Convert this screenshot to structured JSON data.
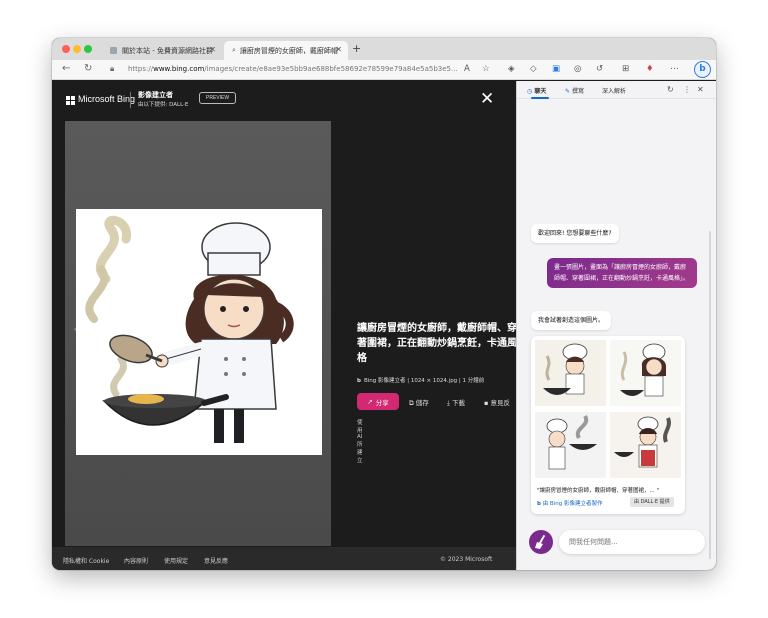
{
  "browser": {
    "tabs": [
      {
        "label": "關於本站 - 免費資源網路社群",
        "active": false
      },
      {
        "label": "讓廚房冒煙的女廚師，戴廚師帽",
        "active": true
      }
    ],
    "new_tab": "+",
    "url_prefix": "https://",
    "url_domain": "www.bing.com",
    "url_path": "/images/create/e8ae93e5bb9ae688bfe58692e78599e79a84e5a5b3e5...",
    "colors": {
      "accent": "#2c7be5"
    }
  },
  "viewer": {
    "brand": "Microsoft Bing",
    "creator_title": "影像建立者",
    "creator_sub": "由以下提供: DALL·E",
    "preview": "PREVIEW",
    "close": "✕",
    "image_title": "讓廚房冒煙的女廚師，戴廚師帽、穿著圍裙，正在翻動炒鍋烹飪，卡通風格",
    "meta": "Bing 影像建立者  |  1024 × 1024.jpg  |  1 分鐘前",
    "share": "分享",
    "save": "儲存",
    "download": "下載",
    "feedback": "意見反",
    "made_with": "使用 AI 所建立",
    "prev_arrow": "‹",
    "next_arrow": "›"
  },
  "footer": {
    "privacy": "隱私權和 Cookie",
    "content_policy": "內容原則",
    "terms": "使用規定",
    "feedback": "意見反應",
    "copyright": "© 2023 Microsoft"
  },
  "chat": {
    "tabs": [
      "聊天",
      "撰寫",
      "深入解析"
    ],
    "welcome": "歡迎回來! 您想要聊些什麼?",
    "user_message": "畫一張圖片，畫面為「讓廚房冒煙的女廚師，戴廚師帽、穿著圍裙，正在翻動炒鍋烹飪，卡通風格」。",
    "bot_reply": "我會試著創造這個圖片。",
    "card_caption": "\"讓廚房冒煙的女廚師，戴廚師帽、穿著圍裙，... \"",
    "card_credit": "由 Bing 影像建立者製作",
    "dalle_chip": "由 DALL·E 提供",
    "input_placeholder": "問我任何問題..."
  }
}
